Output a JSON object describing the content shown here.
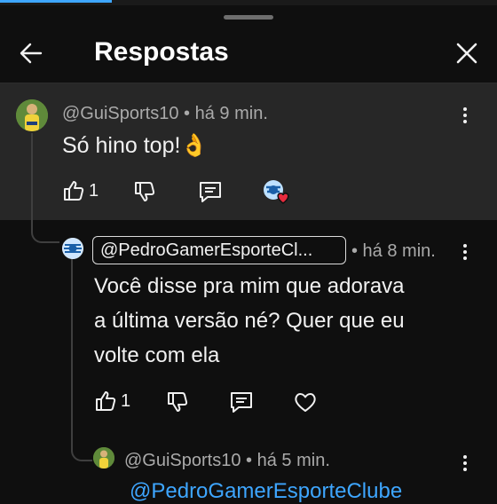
{
  "header": {
    "title": "Respostas",
    "back_icon": "arrow-left-icon",
    "close_icon": "close-icon"
  },
  "comments": [
    {
      "author": "@GuiSports10",
      "time": "• há 9 min.",
      "text": "Só hino top!👌",
      "likes": "1",
      "creator_heart": true
    },
    {
      "author": "@PedroGamerEsporteCl...",
      "time": "• há 8 min.",
      "text_lines": [
        "Você disse pra mim que adorava",
        "a última versão né? Quer que eu",
        "volte com ela"
      ],
      "likes": "1"
    },
    {
      "author": "@GuiSports10",
      "time": "• há 5 min.",
      "mention": "@PedroGamerEsporteClube"
    }
  ],
  "colors": {
    "background": "#0f0f0f",
    "highlight": "#272727",
    "link": "#3ea6ff",
    "meta": "#aaaaaa"
  }
}
